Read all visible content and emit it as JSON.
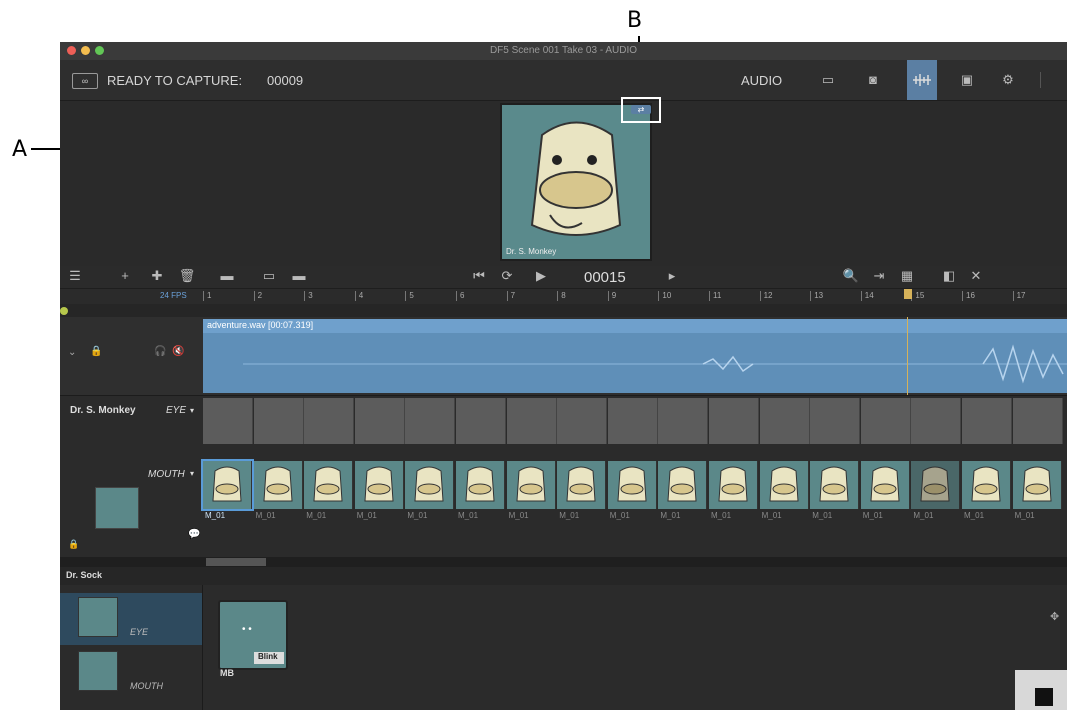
{
  "annotations": {
    "a": "A",
    "b": "B"
  },
  "window": {
    "title": "DF5  Scene 001  Take 03 - AUDIO"
  },
  "toolbar": {
    "capture_label": "READY TO CAPTURE:",
    "frame_number": "00009",
    "mode_label": "AUDIO",
    "icons": [
      "monitor-icon",
      "camera-icon",
      "audio-waveform-icon",
      "capture-icon",
      "settings-icon"
    ]
  },
  "preview": {
    "character_label": "Dr. S. Monkey"
  },
  "transport": {
    "frame_counter": "00015"
  },
  "ruler": {
    "fps": "24 FPS",
    "ticks": [
      "1",
      "2",
      "3",
      "4",
      "5",
      "6",
      "7",
      "8",
      "9",
      "10",
      "11",
      "12",
      "13",
      "14",
      "15",
      "16",
      "17"
    ],
    "playhead_frame": 15
  },
  "audio_track": {
    "clip_label": "adventure.wav [00:07.319]"
  },
  "eye_track": {
    "character": "Dr. S. Monkey",
    "track_label": "EYE"
  },
  "mouth_track": {
    "track_label": "MOUTH",
    "frame_labels": [
      "M_01",
      "M_01",
      "M_01",
      "M_01",
      "M_01",
      "M_01",
      "M_01",
      "M_01",
      "M_01",
      "M_01",
      "M_01",
      "M_01",
      "M_01",
      "M_01",
      "M_01",
      "M_01",
      "M_01"
    ]
  },
  "char_bar": {
    "name": "Dr. Sock"
  },
  "library": {
    "categories": [
      {
        "label": "EYE"
      },
      {
        "label": "MOUTH"
      }
    ],
    "asset": {
      "code": "MB",
      "tag": "Blink"
    }
  },
  "colors": {
    "accent": "#d6b25a",
    "audio_clip": "#5f8fb8",
    "window_bg": "#2b2b2b"
  }
}
